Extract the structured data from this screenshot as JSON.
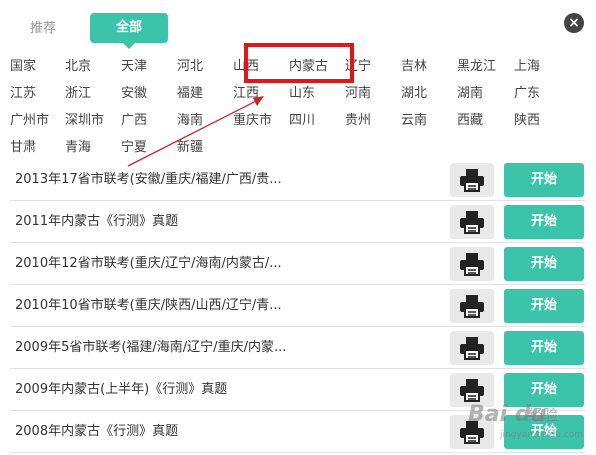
{
  "tabs": {
    "recommend": "推荐",
    "all": "全部"
  },
  "close_icon": "×",
  "regions": [
    "国家",
    "北京",
    "天津",
    "河北",
    "山西",
    "内蒙古",
    "辽宁",
    "吉林",
    "黑龙江",
    "上海",
    "江苏",
    "浙江",
    "安徽",
    "福建",
    "江西",
    "山东",
    "河南",
    "湖北",
    "湖南",
    "广东",
    "广州市",
    "深圳市",
    "广西",
    "海南",
    "重庆市",
    "四川",
    "贵州",
    "云南",
    "西藏",
    "陕西",
    "甘肃",
    "青海",
    "宁夏",
    "新疆"
  ],
  "selected_region": "内蒙古",
  "list": [
    {
      "title": "2013年17省市联考(安徽/重庆/福建/广西/贵...",
      "start": "开始"
    },
    {
      "title": "2011年内蒙古《行测》真题",
      "start": "开始"
    },
    {
      "title": "2010年12省市联考(重庆/辽宁/海南/内蒙古/...",
      "start": "开始"
    },
    {
      "title": "2010年10省市联考(重庆/陕西/山西/辽宁/青...",
      "start": "开始"
    },
    {
      "title": "2009年5省市联考(福建/海南/辽宁/重庆/内蒙...",
      "start": "开始"
    },
    {
      "title": "2009年内蒙古(上半年)《行测》真题",
      "start": "开始"
    },
    {
      "title": "2008年内蒙古《行测》真题",
      "start": "开始"
    }
  ],
  "watermark": {
    "logo": "Bai du",
    "text": "经验",
    "url": "jingyan.baidu.com"
  },
  "colors": {
    "accent": "#3cc4aa",
    "highlight": "#e0161a",
    "arrow": "#c0282a"
  },
  "icons": [
    "close-icon",
    "printer-icon"
  ]
}
